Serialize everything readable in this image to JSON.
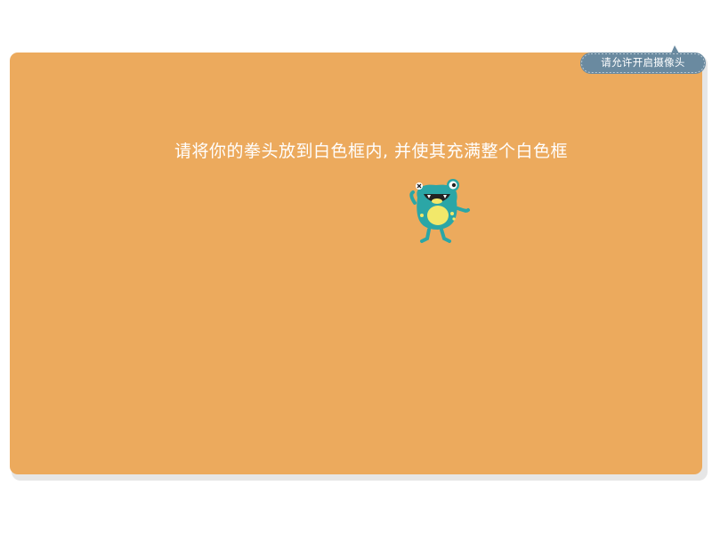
{
  "camera_prompt": {
    "label": "请允许开启摄像头",
    "icon": "speech-bubble"
  },
  "instruction": {
    "text": "请将你的拳头放到白色框内, 并使其充满整个白色框"
  },
  "mascot": {
    "icon": "green-monster-mascot"
  },
  "colors": {
    "panel": "#ecaa5d",
    "bubble": "#6a8aa0",
    "mascot_body": "#2ba6a6",
    "mascot_belly": "#f2e86a",
    "text": "#ffffff"
  }
}
